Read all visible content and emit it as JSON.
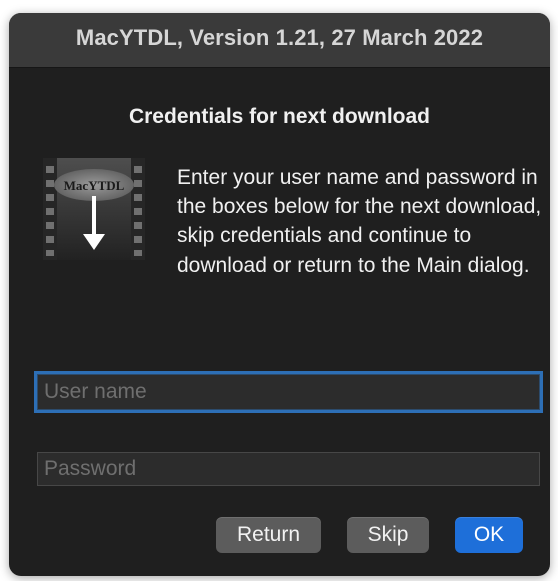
{
  "window": {
    "title": "MacYTDL, Version 1.21, 27 March 2022"
  },
  "dialog": {
    "heading": "Credentials for next download",
    "message": "Enter your user name and password in the boxes below for the next download, skip credentials and continue to download or return to the Main dialog.",
    "app_icon": {
      "name": "macytdl-film-download-icon",
      "label": "MacYTDL"
    }
  },
  "fields": {
    "username": {
      "value": "",
      "placeholder": "User name",
      "focused": true
    },
    "password": {
      "value": "",
      "placeholder": "Password"
    }
  },
  "buttons": {
    "return_label": "Return",
    "skip_label": "Skip",
    "ok_label": "OK"
  },
  "colors": {
    "dialog_background": "#1f1f1f",
    "titlebar_background": "#3a3a3a",
    "text": "#f0f0f0",
    "focus_ring": "#2d6fb6",
    "default_button": "#1e6fd9",
    "secondary_button": "#5c5c5c"
  }
}
